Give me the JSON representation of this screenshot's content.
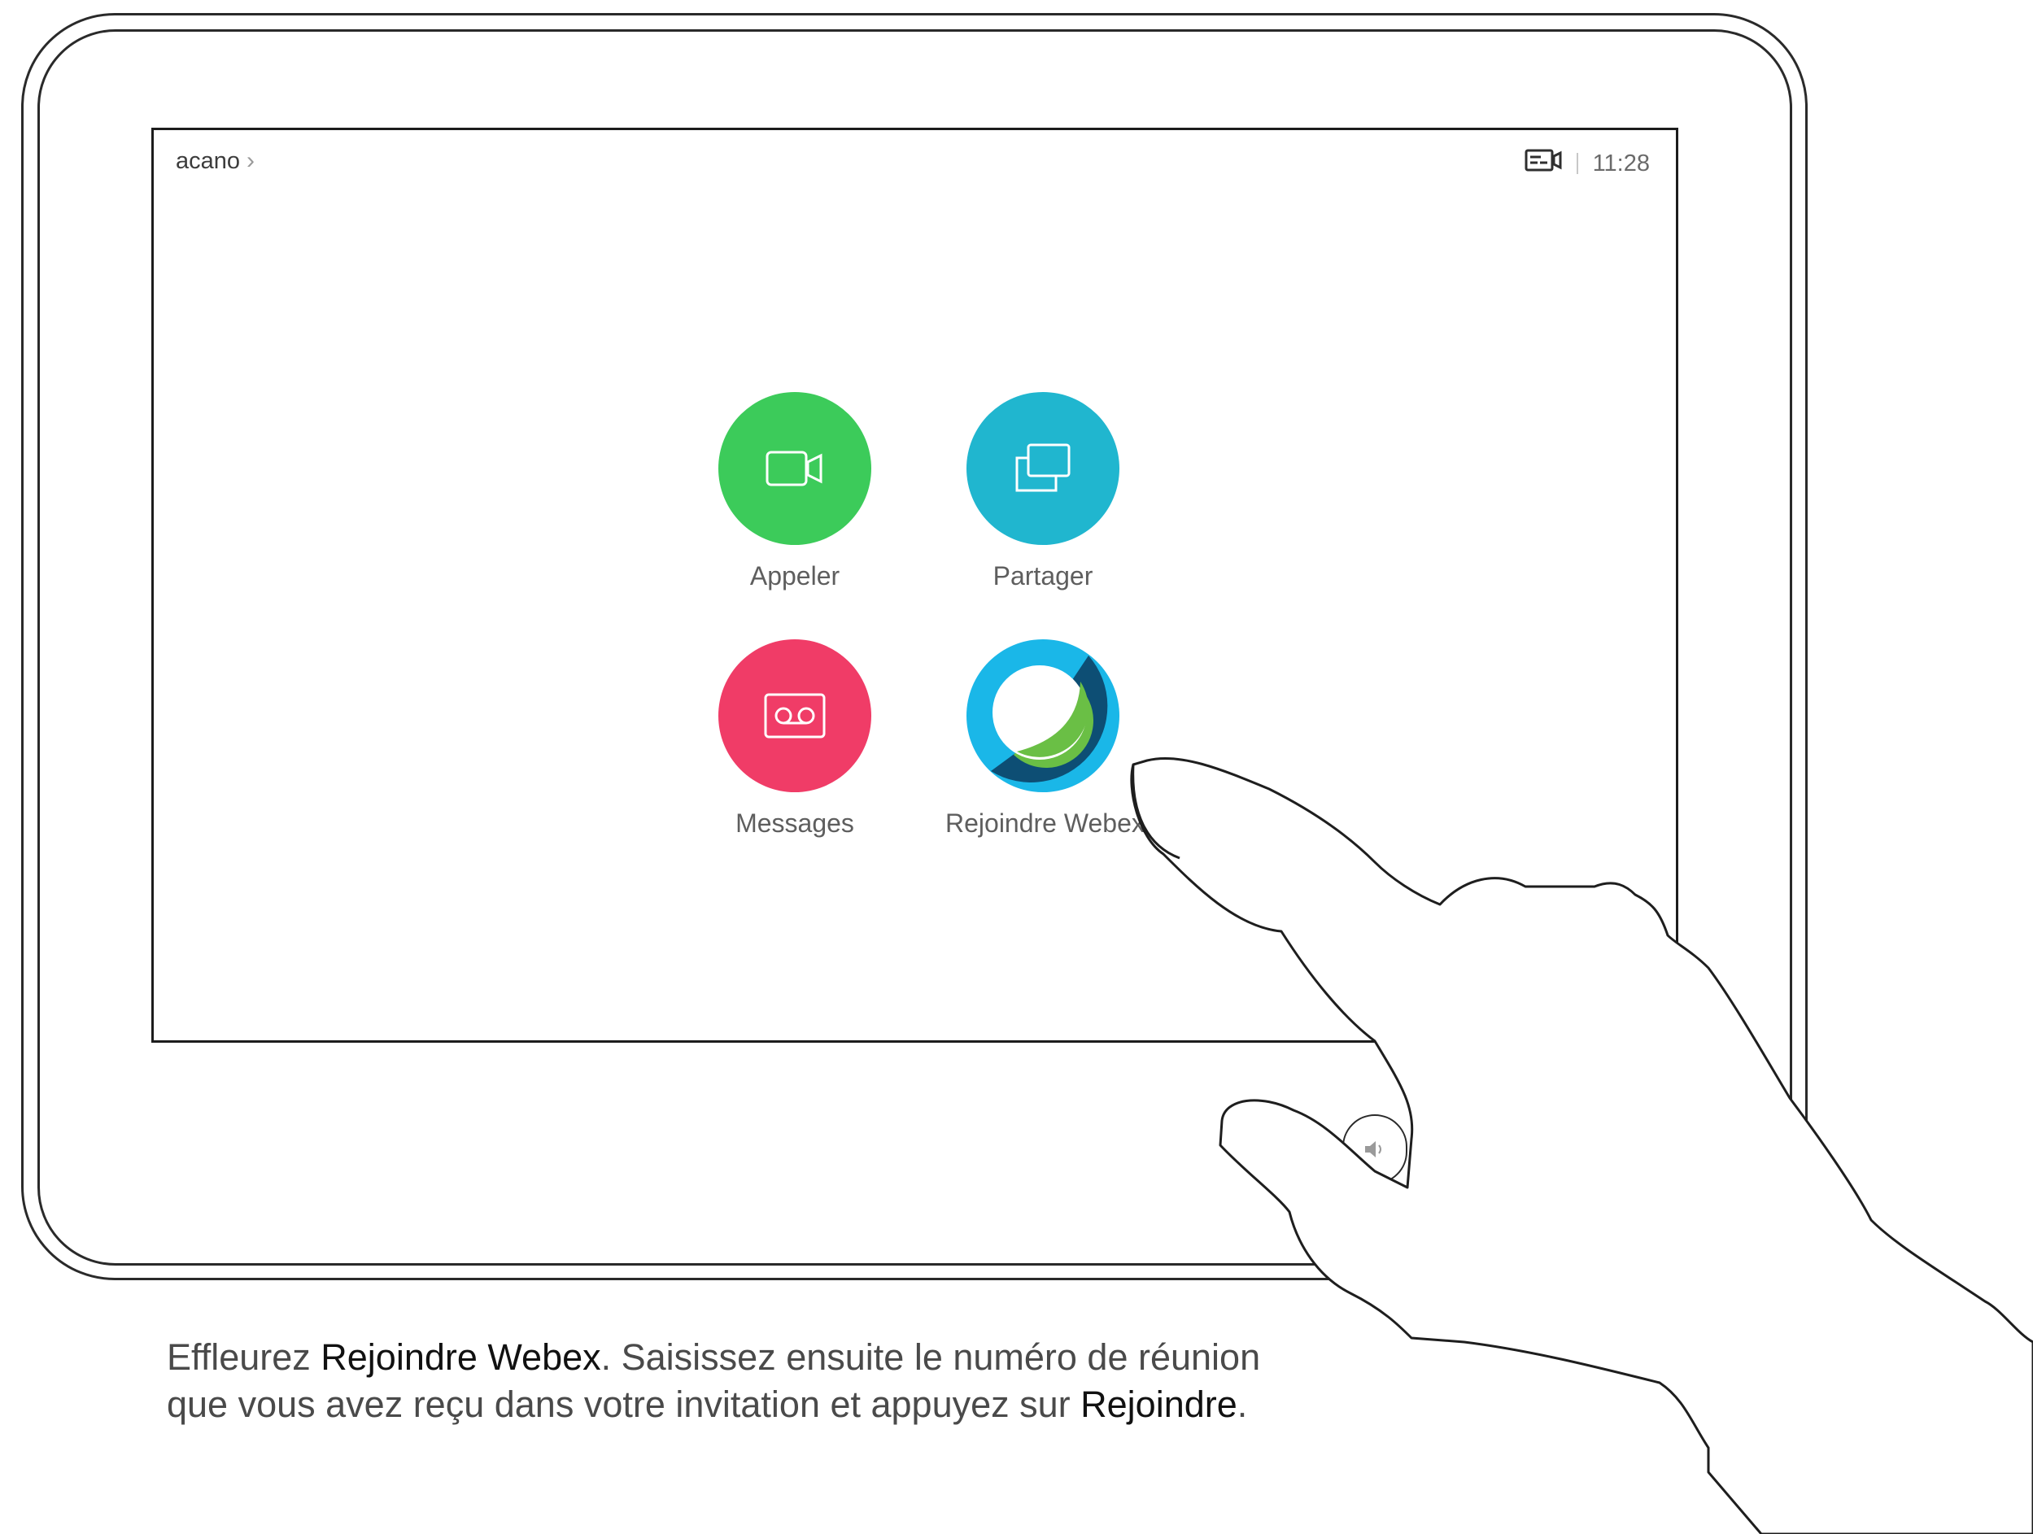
{
  "screen": {
    "breadcrumb": "acano",
    "breadcrumb_chevron": "›",
    "status_icon": "self-view-icon",
    "time": "11:28"
  },
  "apps": [
    {
      "label": "Appeler",
      "icon": "video-camera-icon",
      "color": "#3ccb5a"
    },
    {
      "label": "Partager",
      "icon": "share-screen-icon",
      "color": "#20b6cf"
    },
    {
      "label": "Messages",
      "icon": "voicemail-icon",
      "color": "#f03c67"
    },
    {
      "label": "Rejoindre Webex",
      "icon": "webex-logo-icon",
      "color": "#ffffff"
    }
  ],
  "device": {
    "volume_icon": "speaker-icon"
  },
  "caption": {
    "p1_before": "Effleurez ",
    "p1_bold": "Rejoindre Webex",
    "p1_after": ". Saisissez ensuite le numéro de réunion",
    "p2_before": "que vous avez reçu dans votre invitation et appuyez sur ",
    "p2_bold": "Rejoindre",
    "p2_after": "."
  }
}
